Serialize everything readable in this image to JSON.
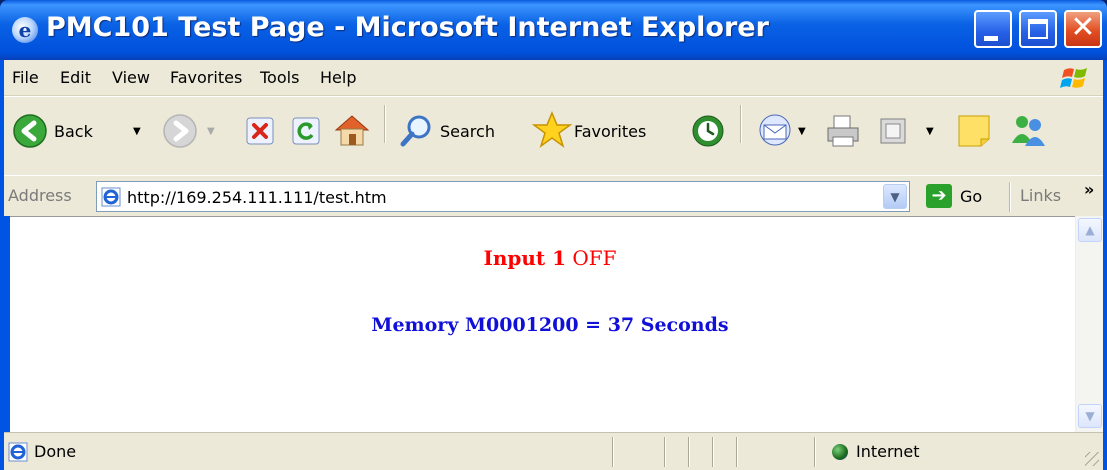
{
  "window": {
    "title": "PMC101 Test Page - Microsoft Internet Explorer",
    "title_icon_glyph": "e"
  },
  "menu": {
    "items": [
      "File",
      "Edit",
      "View",
      "Favorites",
      "Tools",
      "Help"
    ]
  },
  "toolbar": {
    "back_label": "Back",
    "search_label": "Search",
    "favorites_label": "Favorites"
  },
  "address": {
    "label": "Address",
    "url": "http://169.254.111.111/test.htm",
    "go_label": "Go",
    "links_label": "Links"
  },
  "content": {
    "input_label": "Input 1",
    "input_state": "OFF",
    "memory_text": "Memory M0001200 = 37 Seconds"
  },
  "status": {
    "text": "Done",
    "zone": "Internet"
  },
  "colors": {
    "input_color": "#ff0000",
    "memory_color": "#1010d8",
    "titlebar": "#0054e3"
  },
  "icons": {
    "back": "back-arrow-icon",
    "forward": "forward-arrow-icon",
    "stop": "stop-icon",
    "refresh": "refresh-icon",
    "home": "home-icon",
    "search": "search-icon",
    "favorites": "star-icon",
    "history": "history-icon",
    "mail": "mail-icon",
    "print": "print-icon",
    "edit": "edit-icon",
    "discuss": "discuss-icon",
    "messenger": "messenger-icon"
  }
}
